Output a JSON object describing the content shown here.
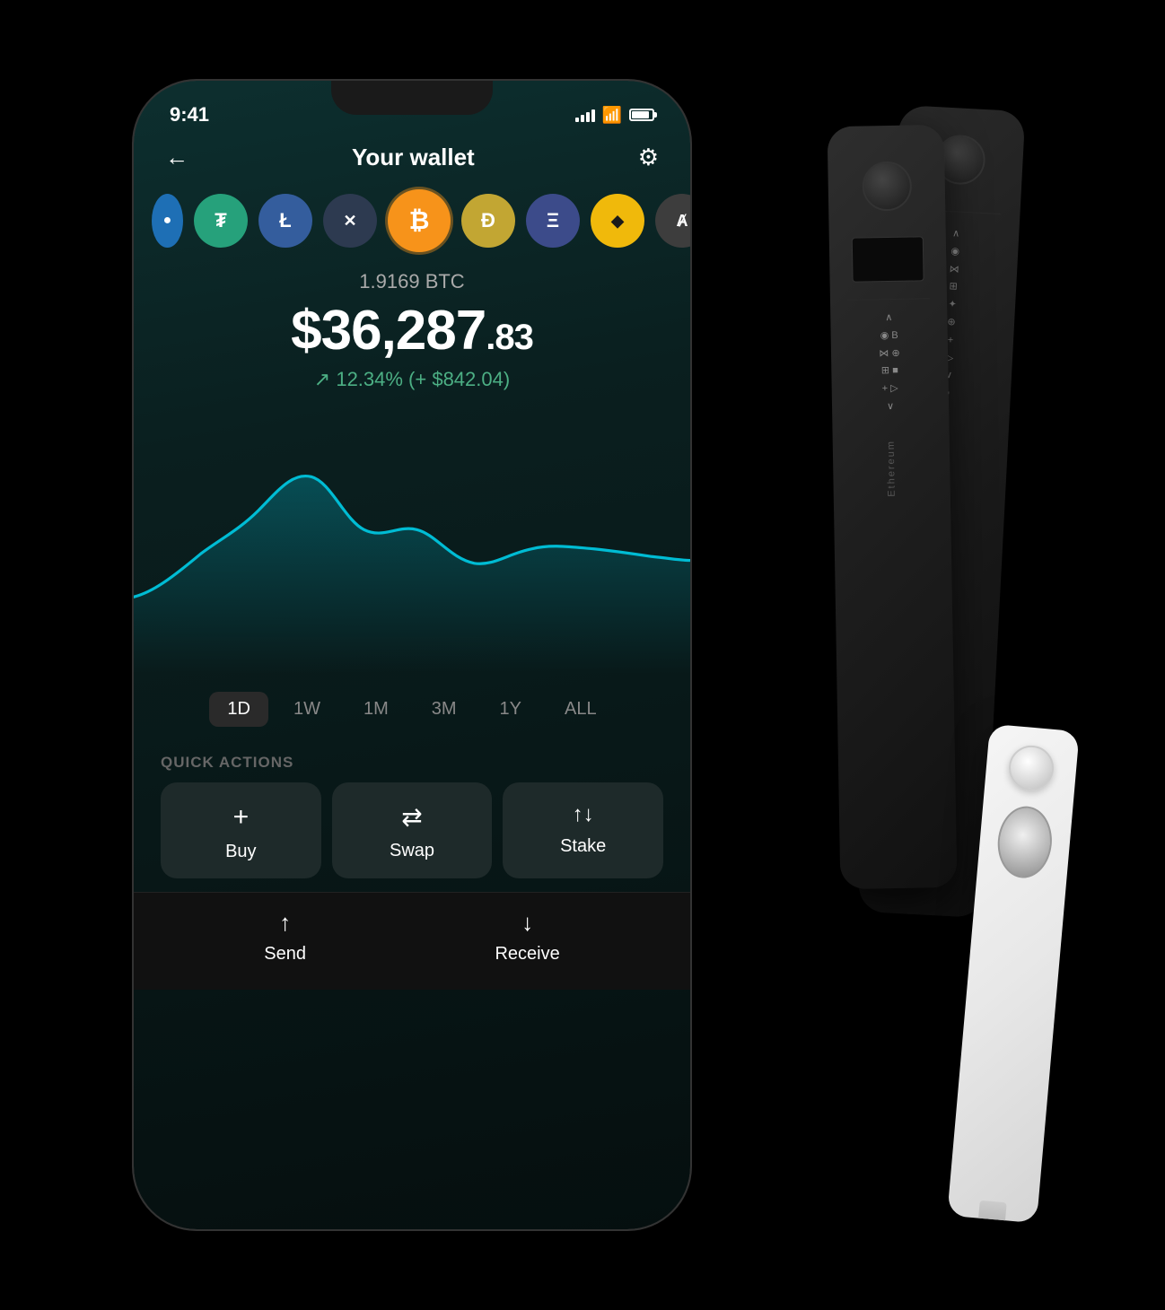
{
  "scene": {
    "background": "#000"
  },
  "statusBar": {
    "time": "9:41",
    "icons": [
      "signal",
      "wifi",
      "battery"
    ]
  },
  "header": {
    "backLabel": "←",
    "title": "Your wallet",
    "settingsLabel": "⚙"
  },
  "coins": [
    {
      "id": "partial-left",
      "symbol": "●",
      "class": "coin-partial-left"
    },
    {
      "id": "tether",
      "symbol": "₮",
      "class": "coin-tether"
    },
    {
      "id": "litecoin",
      "symbol": "Ł",
      "class": "coin-ltc"
    },
    {
      "id": "xrp",
      "symbol": "✕",
      "class": "coin-xrp"
    },
    {
      "id": "bitcoin",
      "symbol": "₿",
      "class": "coin-btc"
    },
    {
      "id": "dogecoin",
      "symbol": "Ð",
      "class": "coin-doge"
    },
    {
      "id": "ethereum",
      "symbol": "Ξ",
      "class": "coin-eth"
    },
    {
      "id": "binance",
      "symbol": "◆",
      "class": "coin-bnb"
    },
    {
      "id": "algorand",
      "symbol": "A",
      "class": "coin-algo"
    }
  ],
  "balance": {
    "cryptoAmount": "1.9169 BTC",
    "usdWhole": "$36,287",
    "usdCents": ".83",
    "change": "↗ 12.34% (+ $842.04)"
  },
  "chart": {
    "timeFilters": [
      {
        "label": "1D",
        "active": true
      },
      {
        "label": "1W",
        "active": false
      },
      {
        "label": "1M",
        "active": false
      },
      {
        "label": "3M",
        "active": false
      },
      {
        "label": "1Y",
        "active": false
      },
      {
        "label": "ALL",
        "active": false
      }
    ]
  },
  "quickActions": {
    "sectionLabel": "QUICK ACTIONS",
    "buttons": [
      {
        "id": "buy",
        "icon": "+",
        "label": "Buy"
      },
      {
        "id": "swap",
        "icon": "⇄",
        "label": "Swap"
      },
      {
        "id": "stake",
        "icon": "↑↓",
        "label": "Stake"
      }
    ]
  },
  "bottomBar": {
    "buttons": [
      {
        "id": "send",
        "icon": "↑",
        "label": "Send"
      },
      {
        "id": "receive",
        "icon": "↓",
        "label": "Receive"
      }
    ]
  }
}
